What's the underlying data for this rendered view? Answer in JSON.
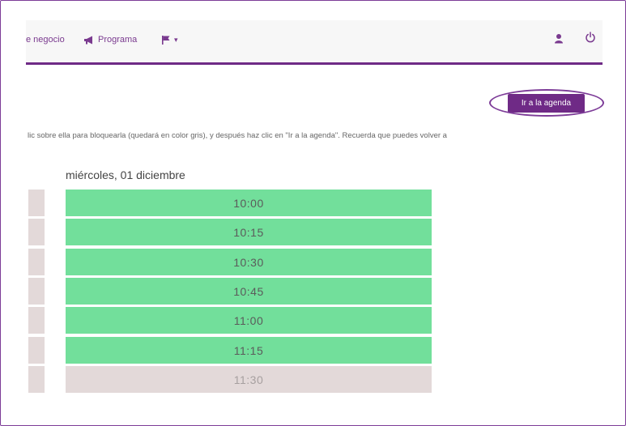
{
  "nav": {
    "negocio_label": "e negocio",
    "programa_label": "Programa",
    "flag_caret": "▾",
    "icons": [
      "megaphone-icon",
      "flag-icon",
      "user-icon",
      "power-icon"
    ],
    "accent": "#6f2a86"
  },
  "action": {
    "agenda_label": "Ir a la agenda"
  },
  "instructions": "lic sobre ella para bloquearla (quedará en color gris), y después haz clic en \"Ir a la agenda\". Recuerda que puedes volver a",
  "day": {
    "header": "miércoles, 01 diciembre",
    "slots": [
      {
        "time": "10:00",
        "status": "available"
      },
      {
        "time": "10:15",
        "status": "available"
      },
      {
        "time": "10:30",
        "status": "available"
      },
      {
        "time": "10:45",
        "status": "available"
      },
      {
        "time": "11:00",
        "status": "available"
      },
      {
        "time": "11:15",
        "status": "available"
      },
      {
        "time": "11:30",
        "status": "blocked"
      }
    ]
  },
  "colors": {
    "available": "#72df9b",
    "blocked": "#e3d9d9"
  }
}
